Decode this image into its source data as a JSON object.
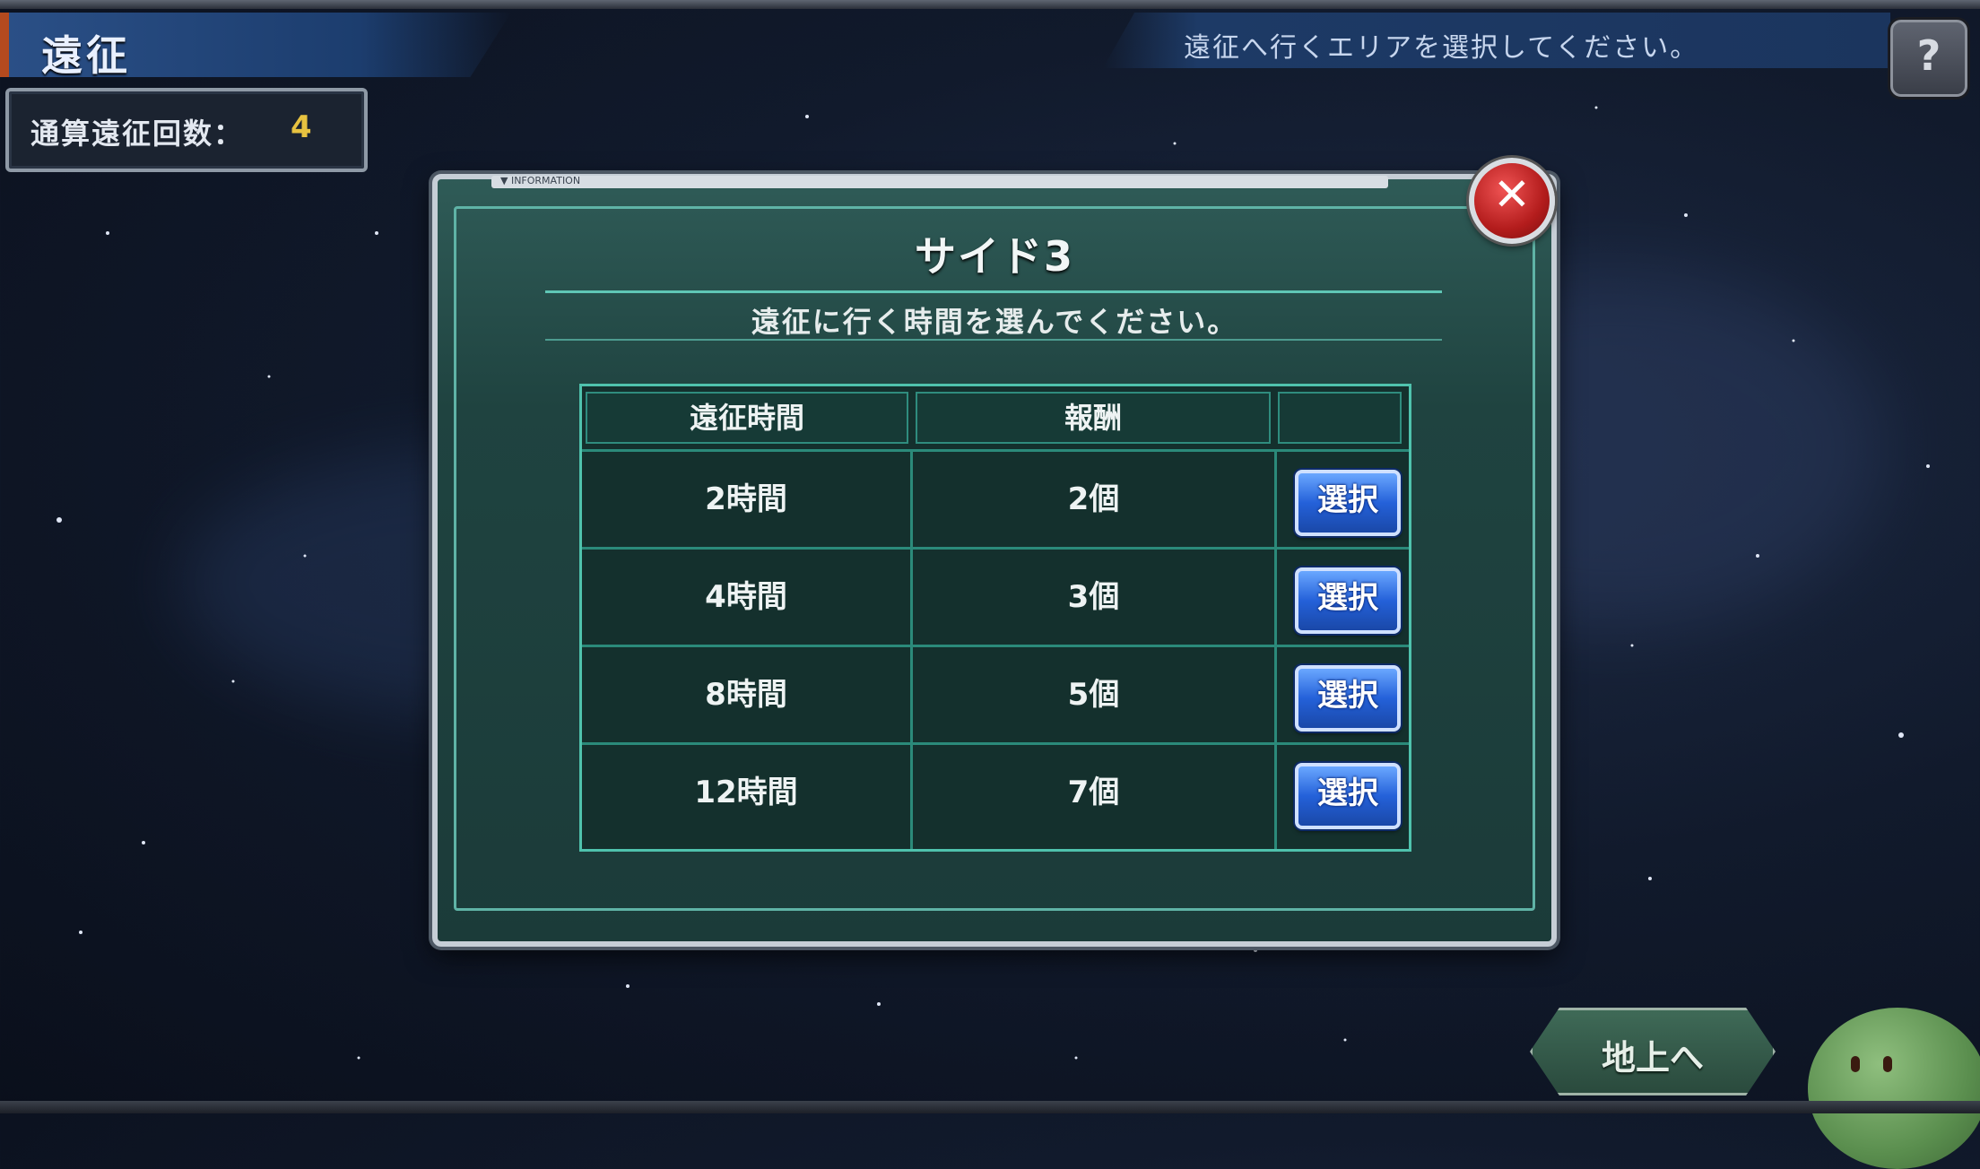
{
  "header": {
    "title": "遠征",
    "instruction": "遠征へ行くエリアを選択してください。",
    "help_label": "?"
  },
  "stats": {
    "label": "通算遠征回数：",
    "value": "4"
  },
  "dialog": {
    "info_tag": "▼ INFORMATION",
    "close_label": "✕",
    "title": "サイド3",
    "subtitle": "遠征に行く時間を選んでください。",
    "columns": [
      "遠征時間",
      "報酬",
      ""
    ],
    "rows": [
      {
        "time": "2時間",
        "reward": "2個",
        "action": "選択"
      },
      {
        "time": "4時間",
        "reward": "3個",
        "action": "選択"
      },
      {
        "time": "8時間",
        "reward": "5個",
        "action": "選択"
      },
      {
        "time": "12時間",
        "reward": "7個",
        "action": "選択"
      }
    ]
  },
  "footer": {
    "ground_button": "地上へ"
  },
  "colors": {
    "accent_teal": "#4fc2ad",
    "dialog_bg": "#1f4340",
    "select_blue": "#2461d9",
    "count_yellow": "#e7c240",
    "close_red": "#b31c1c"
  }
}
